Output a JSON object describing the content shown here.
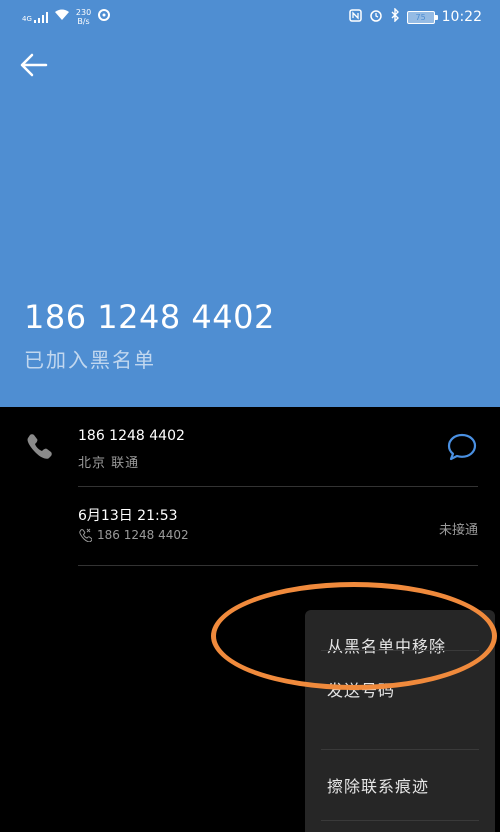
{
  "status_bar": {
    "network": "4G",
    "speed_value": "230",
    "speed_unit": "B/s",
    "battery": "75",
    "time": "10:22"
  },
  "header": {
    "phone_number": "186 1248 4402",
    "status": "已加入黑名单"
  },
  "call_info": {
    "number": "186 1248 4402",
    "location": "北京 联通"
  },
  "call_log": {
    "datetime": "6月13日 21:53",
    "number": "186 1248 4402",
    "status": "未接通"
  },
  "menu": {
    "items": [
      "从黑名单中移除",
      "发送号码",
      "擦除联系痕迹"
    ]
  },
  "colors": {
    "header_bg": "#4f8ed2",
    "accent": "#4a90e2",
    "highlight": "#f08a3c"
  }
}
